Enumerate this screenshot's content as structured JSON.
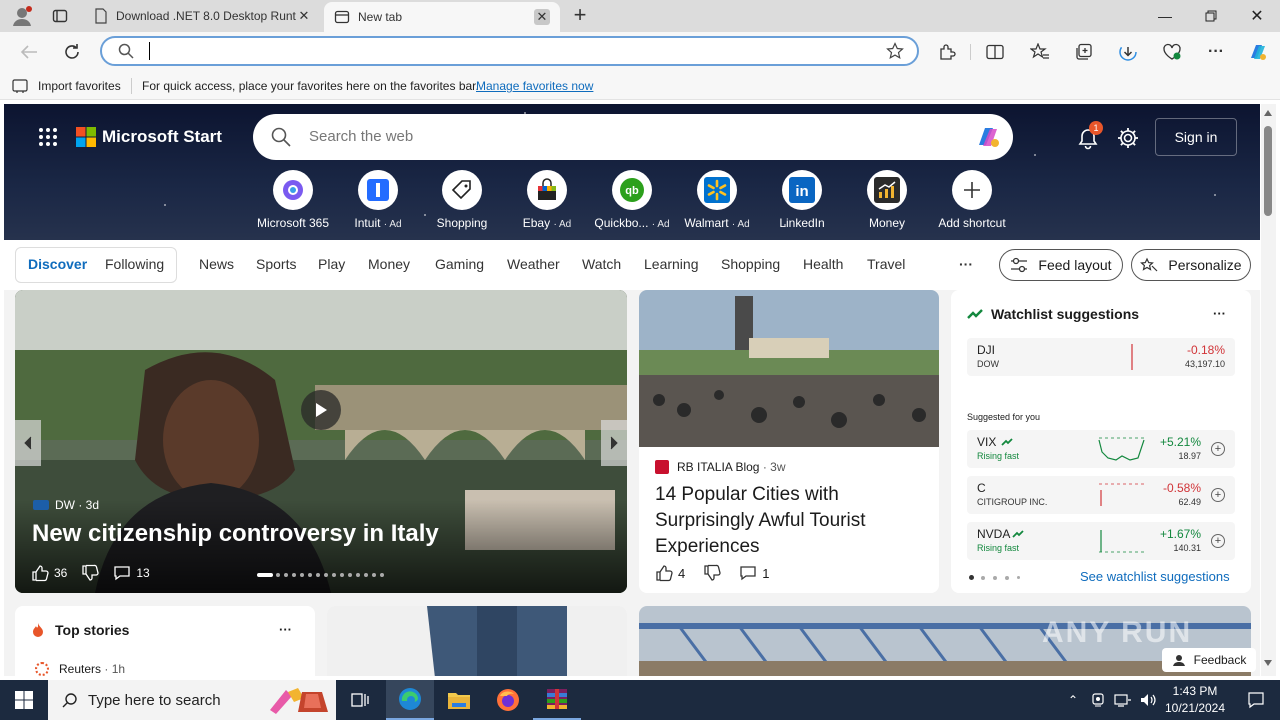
{
  "browser": {
    "tabs": [
      {
        "title": "Download .NET 8.0 Desktop Runt",
        "active": false
      },
      {
        "title": "New tab",
        "active": true
      }
    ],
    "new_tab_symbol": "+",
    "favorites_bar": {
      "import_label": "Import favorites",
      "message": "For quick access, place your favorites here on the favorites bar.",
      "manage_link": "Manage favorites now"
    }
  },
  "msn": {
    "logo": "Microsoft Start",
    "search_placeholder": "Search the web",
    "notification_count": "1",
    "sign_in": "Sign in",
    "shortcuts": [
      {
        "label": "Microsoft 365",
        "ad": "",
        "icon": "microsoft-365-icon",
        "color": "#7a5af0"
      },
      {
        "label": "Intuit",
        "ad": "· Ad",
        "icon": "intuit-icon",
        "color": "#236cff"
      },
      {
        "label": "Shopping",
        "ad": "",
        "icon": "shopping-tag-icon",
        "color": "#222222"
      },
      {
        "label": "Ebay",
        "ad": "· Ad",
        "icon": "ebay-bag-icon",
        "color": "#e53238"
      },
      {
        "label": "Quickbo...",
        "ad": "· Ad",
        "icon": "quickbooks-icon",
        "color": "#2ca01c"
      },
      {
        "label": "Walmart",
        "ad": "· Ad",
        "icon": "walmart-spark-icon",
        "color": "#0071ce"
      },
      {
        "label": "LinkedIn",
        "ad": "",
        "icon": "linkedin-icon",
        "color": "#0a66c2"
      },
      {
        "label": "Money",
        "ad": "",
        "icon": "money-chart-icon",
        "color": "#2b2b2b"
      },
      {
        "label": "Add shortcut",
        "ad": "",
        "icon": "plus-icon",
        "color": "#333333"
      }
    ],
    "nav": {
      "tabs": [
        "Discover",
        "Following"
      ],
      "categories": [
        "News",
        "Sports",
        "Play",
        "Money",
        "Gaming",
        "Weather",
        "Watch",
        "Learning",
        "Shopping",
        "Health",
        "Travel"
      ],
      "more": "···",
      "feed_layout": "Feed layout",
      "personalize": "Personalize"
    },
    "hero": {
      "source": "DW",
      "age": "· 3d",
      "headline": "New citizenship controversy in Italy",
      "likes": "36",
      "comments": "13"
    },
    "story2": {
      "source": "RB ITALIA Blog",
      "age": "· 3w",
      "headline": "14 Popular Cities with Surprisingly Awful Tourist Experiences",
      "likes": "4",
      "comments": "1"
    },
    "watchlist": {
      "title": "Watchlist suggestions",
      "more": "···",
      "main": {
        "symbol": "DJI",
        "name": "DOW",
        "change": "-0.18%",
        "price": "43,197.10"
      },
      "suggested_label": "Suggested for you",
      "suggestions": [
        {
          "symbol": "VIX",
          "tag": "Rising fast",
          "change": "+5.21%",
          "price": "18.97",
          "trend": "up"
        },
        {
          "symbol": "C",
          "tag": "CITIGROUP INC.",
          "change": "-0.58%",
          "price": "62.49",
          "trend": "down"
        },
        {
          "symbol": "NVDA",
          "tag": "Rising fast",
          "change": "+1.67%",
          "price": "140.31",
          "trend": "up"
        }
      ],
      "see_link": "See watchlist suggestions"
    },
    "top_stories": {
      "title": "Top stories",
      "more": "···",
      "source": "Reuters",
      "age": "· 1h"
    },
    "feedback": "Feedback"
  },
  "taskbar": {
    "search_placeholder": "Type here to search",
    "time": "1:43 PM",
    "date": "10/21/2024"
  },
  "watermark": "ANY RUN",
  "colors": {
    "accent": "#0f6cbd",
    "negative": "#d13438",
    "positive": "#13883e"
  }
}
